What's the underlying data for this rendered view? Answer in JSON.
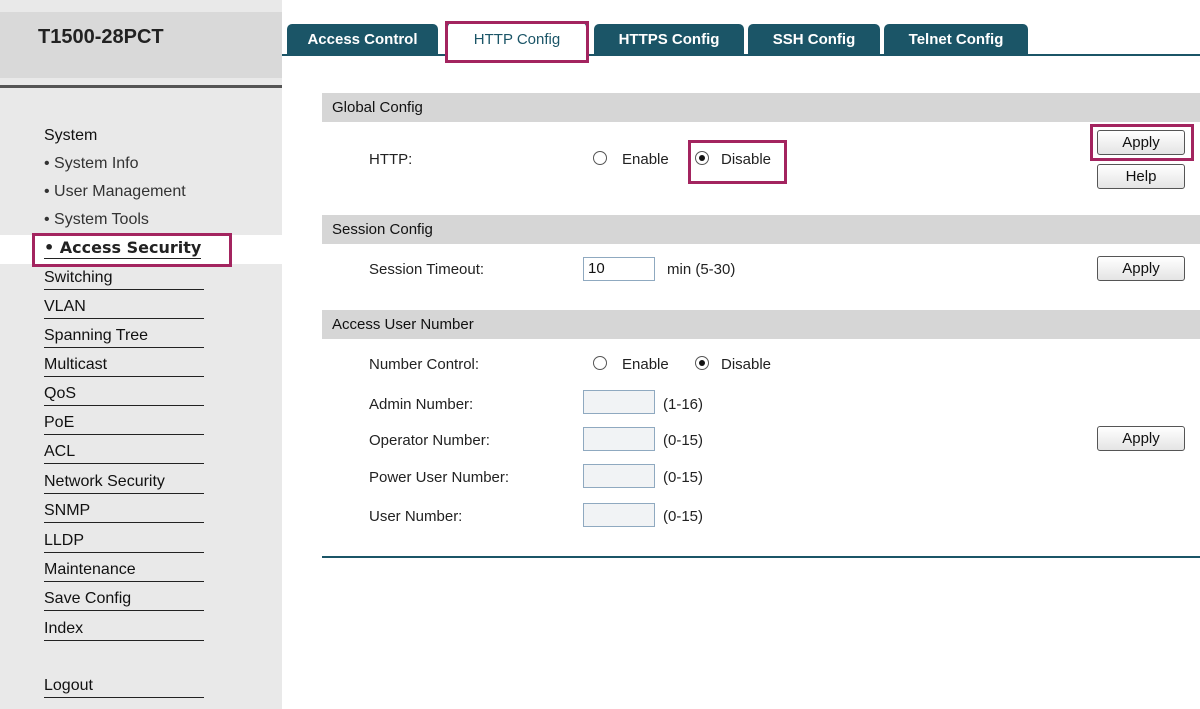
{
  "app": {
    "title": "T1500-28PCT"
  },
  "sidebar": {
    "items": [
      {
        "label": "System"
      },
      {
        "label": "• System Info"
      },
      {
        "label": "• User Management"
      },
      {
        "label": "• System Tools"
      },
      {
        "label": "• Access Security"
      },
      {
        "label": "Switching"
      },
      {
        "label": "VLAN"
      },
      {
        "label": "Spanning Tree"
      },
      {
        "label": "Multicast"
      },
      {
        "label": "QoS"
      },
      {
        "label": "PoE"
      },
      {
        "label": "ACL"
      },
      {
        "label": "Network Security"
      },
      {
        "label": "SNMP"
      },
      {
        "label": "LLDP"
      },
      {
        "label": "Maintenance"
      },
      {
        "label": "Save Config"
      },
      {
        "label": "Index"
      },
      {
        "label": "Logout"
      }
    ]
  },
  "tabs": [
    {
      "label": "Access Control"
    },
    {
      "label": "HTTP Config"
    },
    {
      "label": "HTTPS Config"
    },
    {
      "label": "SSH Config"
    },
    {
      "label": "Telnet Config"
    }
  ],
  "global_config": {
    "title": "Global Config",
    "http_label": "HTTP:",
    "enable_label": "Enable",
    "disable_label": "Disable",
    "selected": "Disable",
    "apply": "Apply",
    "help": "Help"
  },
  "session_config": {
    "title": "Session Config",
    "timeout_label": "Session Timeout:",
    "timeout_value": "10",
    "unit": "min (5-30)",
    "apply": "Apply"
  },
  "access_user": {
    "title": "Access User Number",
    "number_control_label": "Number Control:",
    "enable_label": "Enable",
    "disable_label": "Disable",
    "selected": "Disable",
    "rows": [
      {
        "label": "Admin Number:",
        "range": "(1-16)",
        "value": ""
      },
      {
        "label": "Operator Number:",
        "range": "(0-15)",
        "value": ""
      },
      {
        "label": "Power User Number:",
        "range": "(0-15)",
        "value": ""
      },
      {
        "label": "User Number:",
        "range": "(0-15)",
        "value": ""
      }
    ],
    "apply": "Apply"
  },
  "colors": {
    "tab_bg": "#1b5567",
    "highlight": "#a3245f",
    "section_bg": "#d6d6d6",
    "sidebar_bg": "#e9e9e9"
  }
}
